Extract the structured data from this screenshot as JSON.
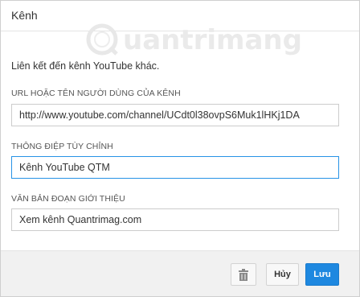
{
  "dialog": {
    "title": "Kênh",
    "intro": "Liên kết đến kênh YouTube khác.",
    "watermark": "uantrimang"
  },
  "fields": [
    {
      "label": "URL HOẶC TÊN NGƯỜI DÙNG CỦA KÊNH",
      "value": "http://www.youtube.com/channel/UCdt0l38ovpS6Muk1lHKj1DA"
    },
    {
      "label": "THÔNG ĐIỆP TÙY CHỈNH",
      "value": "Kênh YouTube QTM"
    },
    {
      "label": "VĂN BẢN ĐOẠN GIỚI THIỆU",
      "value": "Xem kênh Quantrimag.com"
    }
  ],
  "buttons": {
    "delete_icon": "trash-icon",
    "cancel": "Hủy",
    "save": "Lưu"
  },
  "colors": {
    "accent": "#1e88e0",
    "focus_border": "#2793e6"
  }
}
